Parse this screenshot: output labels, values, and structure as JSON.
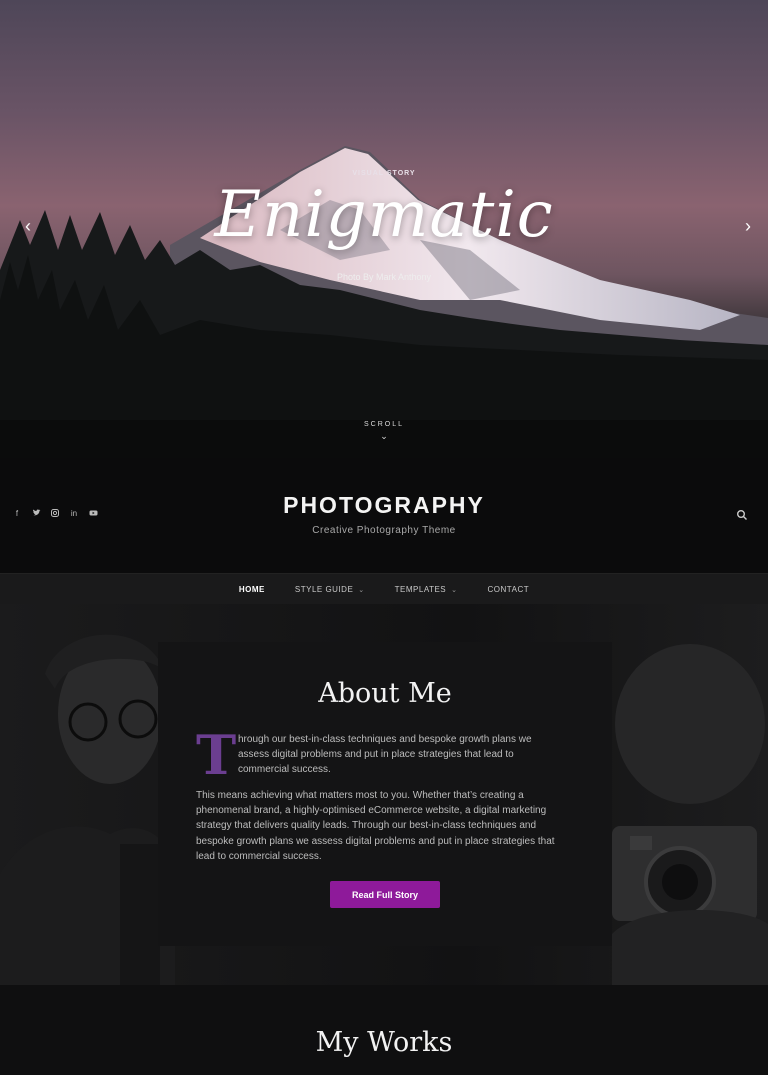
{
  "hero": {
    "kicker": "VISUAL STORY",
    "title": "Enigmatic",
    "credit": "Photo By Mark Anthony",
    "prev_label": "‹",
    "next_label": "›",
    "scroll_label": "SCROLL"
  },
  "header": {
    "brand": "PHOTOGRAPHY",
    "tagline": "Creative Photography Theme",
    "socials": [
      "f",
      "t",
      "ig",
      "in",
      "yt"
    ]
  },
  "nav": {
    "items": [
      {
        "label": "HOME"
      },
      {
        "label": "STYLE GUIDE"
      },
      {
        "label": "TEMPLATES"
      },
      {
        "label": "CONTACT"
      }
    ]
  },
  "about": {
    "title": "About Me",
    "dropcap": "T",
    "p1": "hrough our best-in-class techniques and bespoke growth plans we assess digital problems and put in place strategies that lead to commercial success.",
    "p2": "This means achieving what matters most to you. Whether that’s creating a phenomenal brand, a highly-optimised eCommerce website, a digital marketing strategy that delivers quality leads. Through our best-in-class techniques and bespoke growth plans we assess digital problems and put in place strategies that lead to commercial success.",
    "button": "Read Full Story"
  },
  "works": {
    "title": "My Works"
  },
  "colors": {
    "accent": "#8e1a9a",
    "dropcap": "#6b3e90",
    "background": "#0f0f10"
  }
}
